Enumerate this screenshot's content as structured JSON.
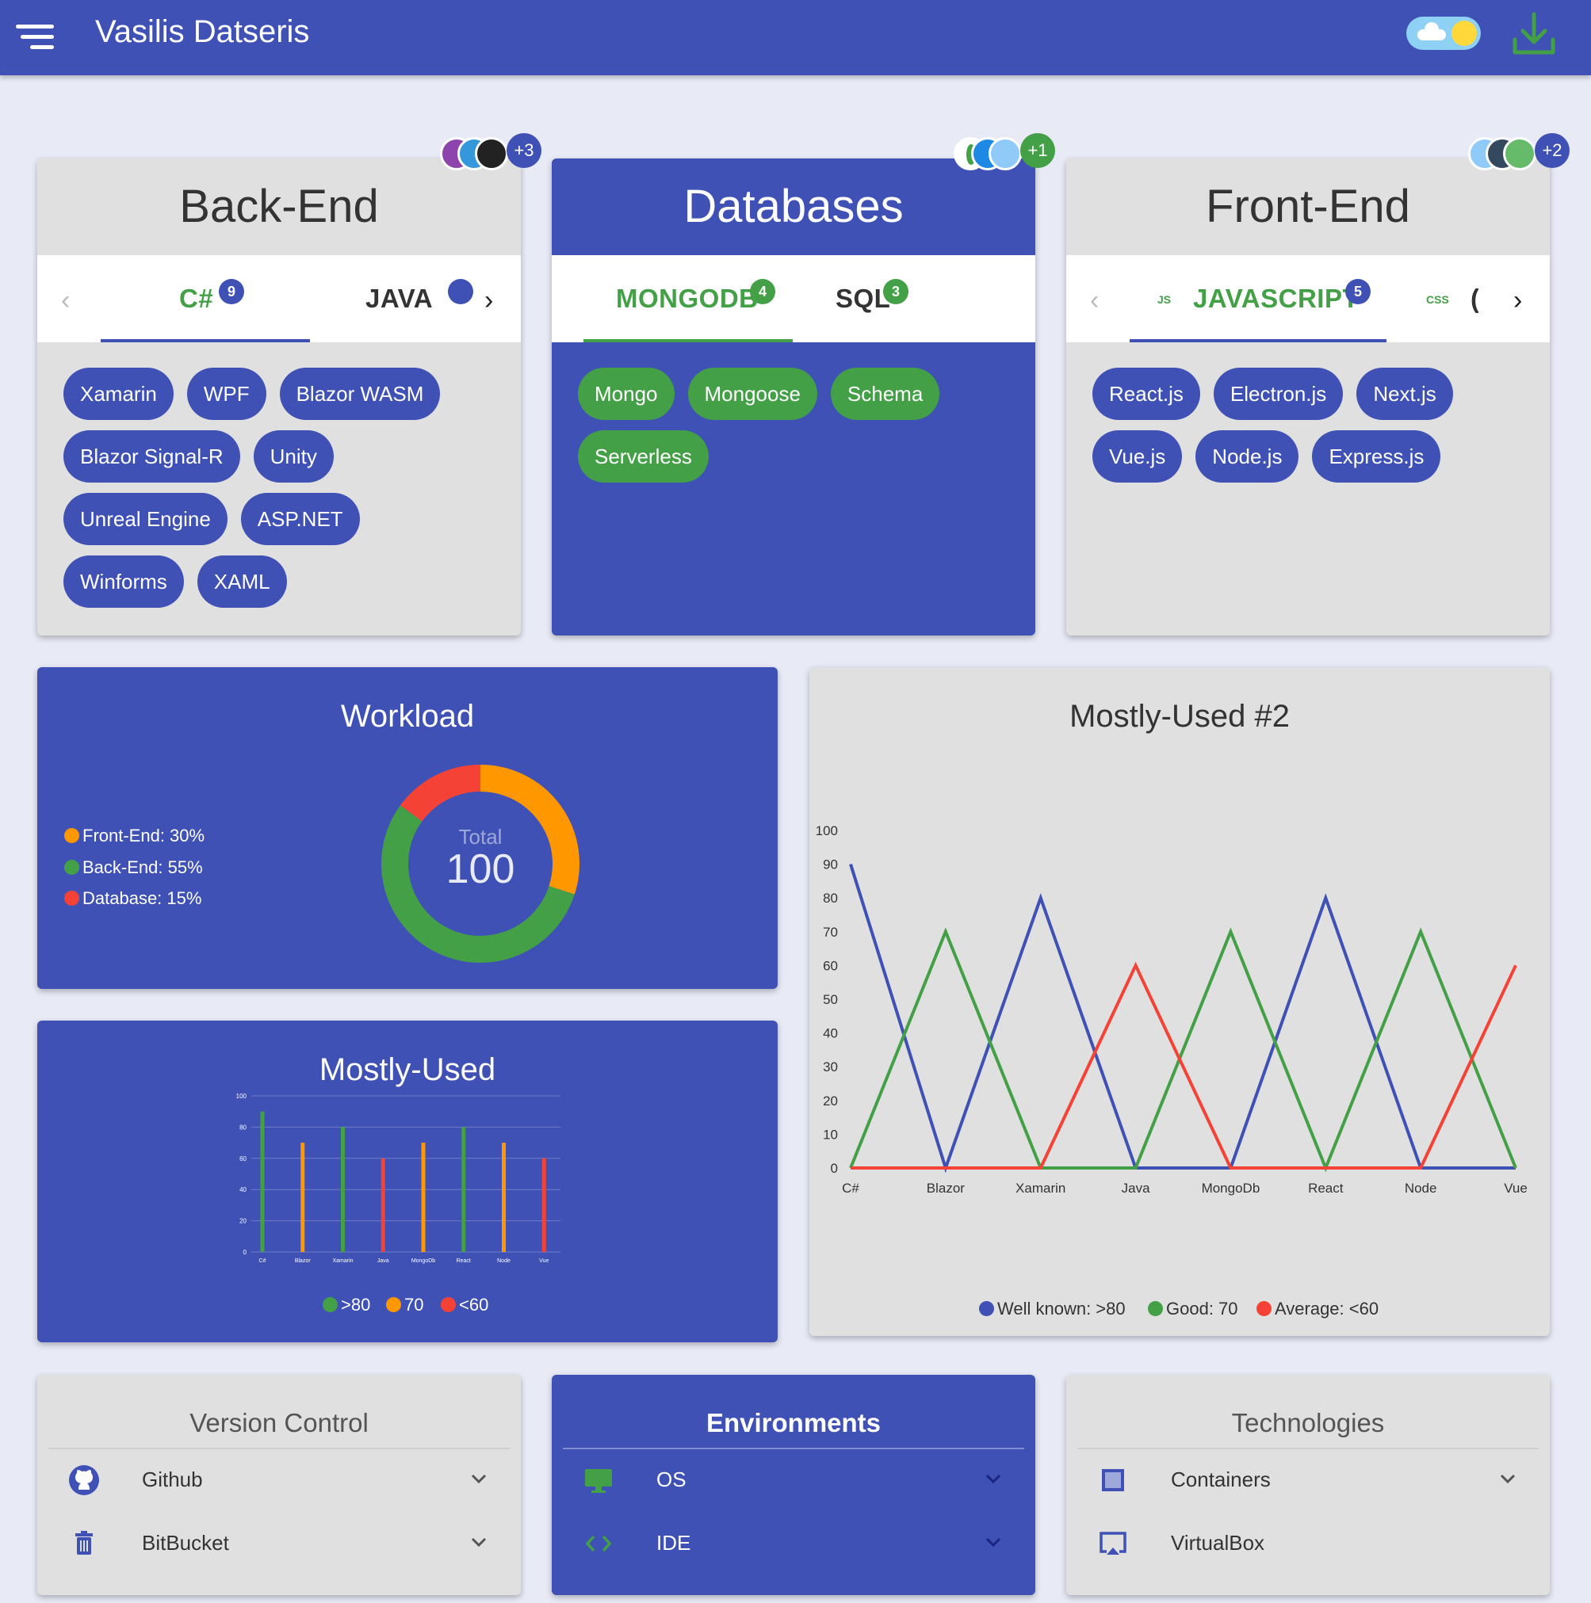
{
  "app": {
    "title": "Vasilis Datseris",
    "colors": {
      "primary": "#3f51b5",
      "green": "#43a047",
      "orange": "#ff9800",
      "red": "#f44336",
      "card_grey": "#e0e0e0"
    }
  },
  "skills": [
    {
      "title": "Back-End",
      "avatar_more": "+3",
      "tabs": [
        {
          "label": "C#",
          "count": "9"
        },
        {
          "label": "JAVA",
          "count": ""
        }
      ],
      "chips": [
        "Xamarin",
        "WPF",
        "Blazor WASM",
        "Blazor Signal-R",
        "Unity",
        "Unreal Engine",
        "ASP.NET",
        "Winforms",
        "XAML"
      ]
    },
    {
      "title": "Databases",
      "avatar_more": "+1",
      "tabs": [
        {
          "label": "MONGODB",
          "count": "4"
        },
        {
          "label": "SQL",
          "count": "3"
        }
      ],
      "chips": [
        "Mongo",
        "Mongoose",
        "Schema",
        "Serverless"
      ]
    },
    {
      "title": "Front-End",
      "avatar_more": "+2",
      "tabs": [
        {
          "label": "JAVASCRIPT",
          "prefix": "JS",
          "count": "5"
        },
        {
          "label": "CSS",
          "prefix": "CSS",
          "count": ""
        }
      ],
      "chips": [
        "React.js",
        "Electron.js",
        "Next.js",
        "Vue.js",
        "Node.js",
        "Express.js"
      ]
    }
  ],
  "workload": {
    "title": "Workload",
    "total_label": "Total",
    "total_value": "100",
    "legend": [
      "Front-End: 30%",
      "Back-End: 55%",
      "Database: 15%"
    ],
    "chart_data": {
      "type": "pie",
      "categories": [
        "Front-End",
        "Back-End",
        "Database"
      ],
      "values": [
        30,
        55,
        15
      ],
      "colors": [
        "#ff9800",
        "#43a047",
        "#f44336"
      ]
    }
  },
  "mostly_used": {
    "title": "Mostly-Used",
    "legend": [
      ">80",
      "70",
      "<60"
    ],
    "chart_data": {
      "type": "bar",
      "categories": [
        "C#",
        "Blazor",
        "Xamarin",
        "Java",
        "MongoDb",
        "React",
        "Node",
        "Vue"
      ],
      "values": [
        90,
        70,
        80,
        60,
        70,
        80,
        70,
        60
      ],
      "colors": [
        "#43a047",
        "#ff9800",
        "#43a047",
        "#f44336",
        "#ff9800",
        "#43a047",
        "#ff9800",
        "#f44336"
      ],
      "ylim": [
        0,
        100
      ],
      "yticks": [
        "0",
        "20",
        "40",
        "60",
        "80",
        "100"
      ]
    }
  },
  "mostly_used_2": {
    "title": "Mostly-Used #2",
    "legend": [
      "Well known: >80",
      "Good: 70",
      "Average: <60"
    ],
    "chart_data": {
      "type": "line",
      "x": [
        "C#",
        "Blazor",
        "Xamarin",
        "Java",
        "MongoDb",
        "React",
        "Node",
        "Vue"
      ],
      "series": [
        {
          "name": "Well known: >80",
          "color": "#3f51b5",
          "values": [
            90,
            0,
            80,
            0,
            0,
            80,
            0,
            0
          ]
        },
        {
          "name": "Good: 70",
          "color": "#43a047",
          "values": [
            0,
            70,
            0,
            0,
            70,
            0,
            70,
            0
          ]
        },
        {
          "name": "Average: <60",
          "color": "#f44336",
          "values": [
            0,
            0,
            0,
            60,
            0,
            0,
            0,
            60
          ]
        }
      ],
      "ylim": [
        0,
        100
      ],
      "yticks": [
        "0",
        "10",
        "20",
        "30",
        "40",
        "50",
        "60",
        "70",
        "80",
        "90",
        "100"
      ]
    }
  },
  "lists": [
    {
      "title": "Version Control",
      "items": [
        {
          "label": "Github",
          "icon": "github-icon"
        },
        {
          "label": "BitBucket",
          "icon": "bucket-icon"
        }
      ]
    },
    {
      "title": "Environments",
      "items": [
        {
          "label": "OS",
          "icon": "monitor-icon"
        },
        {
          "label": "IDE",
          "icon": "code-icon"
        }
      ]
    },
    {
      "title": "Technologies",
      "items": [
        {
          "label": "Containers",
          "icon": "square-icon"
        },
        {
          "label": "VirtualBox",
          "icon": "cast-icon"
        }
      ]
    }
  ]
}
